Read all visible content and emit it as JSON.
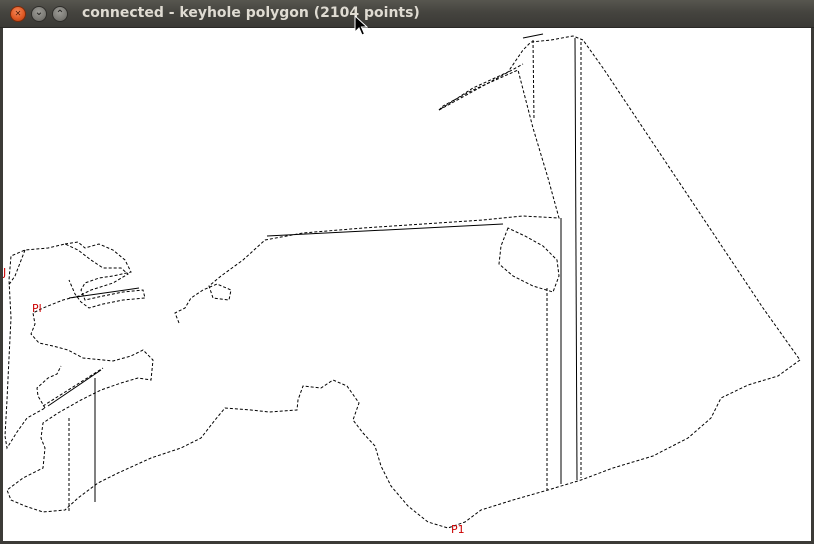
{
  "window": {
    "title": "connected - keyhole polygon (2104 points)",
    "buttons": {
      "close_glyph": "✕",
      "minimize_glyph": "⌄",
      "maximize_glyph": "⌃"
    }
  },
  "canvas": {
    "background": "#ffffff",
    "stroke_color": "#000000",
    "label_color": "#cc0000",
    "labels": {
      "left": "Pl",
      "bottom": "P1",
      "edge": "J"
    }
  }
}
